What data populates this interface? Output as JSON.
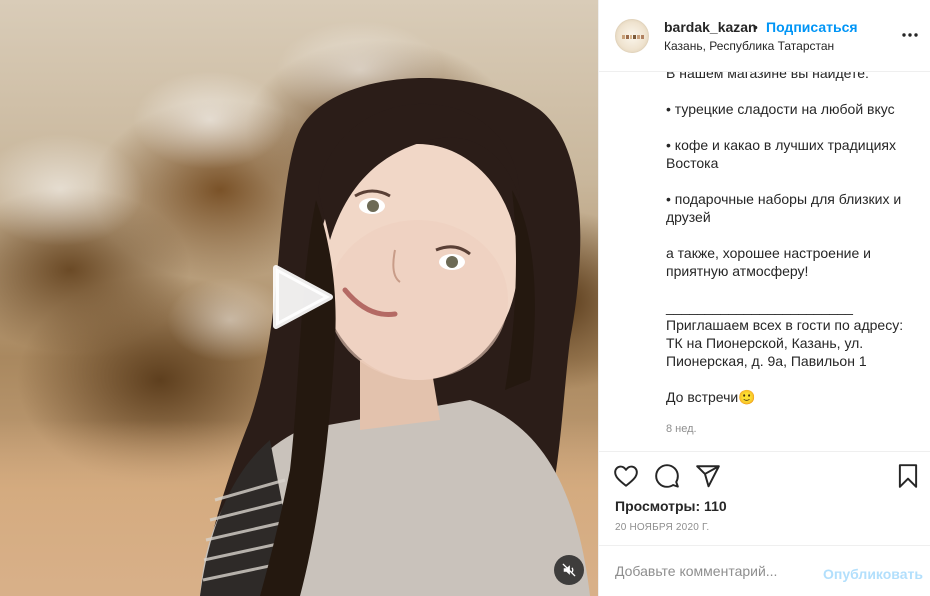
{
  "post": {
    "username": "bardak_kazan",
    "separator": "•",
    "follow_label": "Подписаться",
    "location": "Казань, Республика Татарстан",
    "more_icon": "more-horizontal-icon"
  },
  "caption": {
    "text": "В нашем магазине вы найдете:\n\n• турецкие сладости на любой вкус\n\n• кофе и какао в лучших традициях Востока\n\n• подарочные наборы для близких и друзей\n\nа также, хорошее настроение и приятную атмосферу!\n\n________________________\nПриглашаем всех в гости по адресу: ТК на Пионерской, Казань, ул. Пионерская, д. 9а, Павильон 1\n\nДо встречи🙂",
    "time_ago": "8 нед."
  },
  "actions": {
    "like_icon": "heart-icon",
    "comment_icon": "comment-icon",
    "share_icon": "send-icon",
    "save_icon": "bookmark-icon",
    "views_label": "Просмотры: 110",
    "date": "20 НОЯБРЯ 2020 Г."
  },
  "comment": {
    "placeholder": "Добавьте комментарий...",
    "publish_label": "Опубликовать"
  },
  "media": {
    "play_icon": "play-icon",
    "mute_icon": "muted-speaker-icon"
  },
  "colors": {
    "accent": "#0095f6",
    "publish_disabled": "#b2dffc",
    "secondary_text": "#8e8e8e",
    "border": "#efefef"
  }
}
